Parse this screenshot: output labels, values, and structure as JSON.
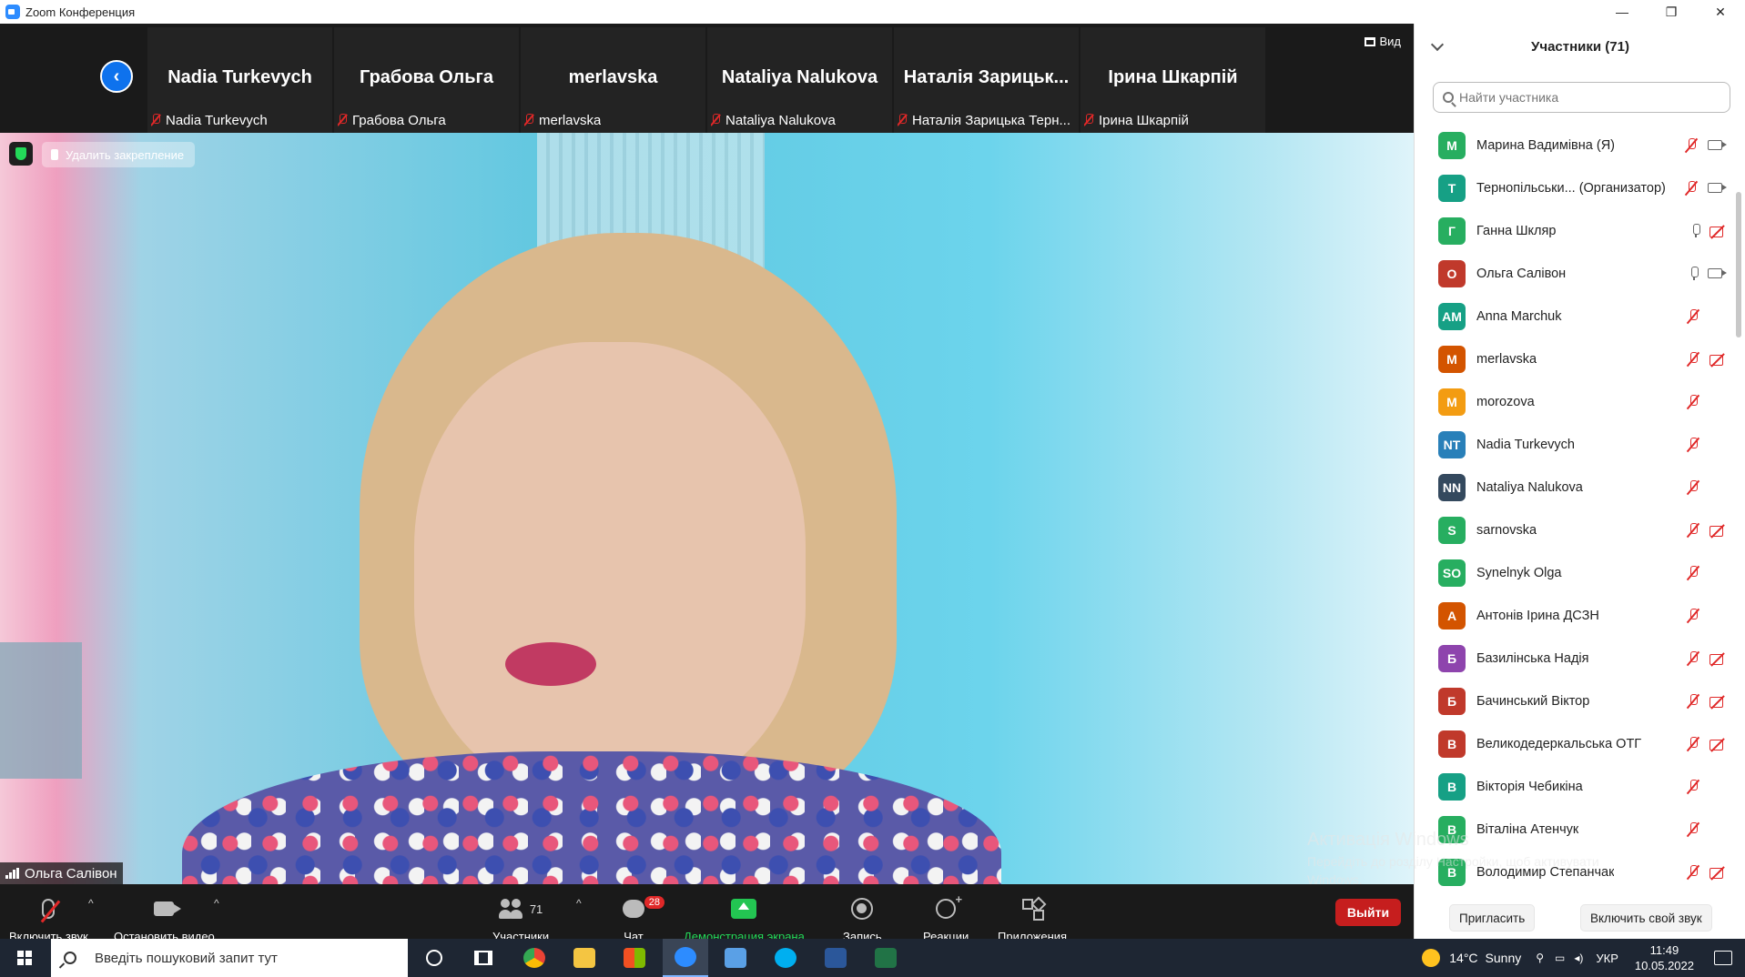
{
  "window": {
    "title": "Zoom Конференция",
    "controls": [
      "—",
      "❐",
      "✕"
    ]
  },
  "strip": {
    "view_label": "Вид",
    "thumbnails": [
      {
        "big": "Nadia Turkevych",
        "small": "Nadia Turkevych"
      },
      {
        "big": "Грабова Ольга",
        "small": "Грабова Ольга"
      },
      {
        "big": "merlavska",
        "small": "merlavska"
      },
      {
        "big": "Nataliya Nalukova",
        "small": "Nataliya Nalukova"
      },
      {
        "big": "Наталія Зарицьк...",
        "small": "Наталія Зарицька Терн..."
      },
      {
        "big": "Ірина Шкарпій",
        "small": "Ірина Шкарпій"
      }
    ]
  },
  "video": {
    "unpin_label": "Удалить закрепление",
    "speaker_name": "Ольга Салівон"
  },
  "toolbar": {
    "unmute_label": "Включить звук",
    "stop_video_label": "Остановить видео",
    "participants_label": "Участники",
    "participants_count": "71",
    "chat_label": "Чат",
    "chat_badge": "28",
    "share_label": "Демонстрация экрана",
    "record_label": "Запись",
    "reactions_label": "Реакции",
    "apps_label": "Приложения",
    "leave_label": "Выйти",
    "share_color": "#23d959",
    "leave_color": "#c61e1e"
  },
  "panel": {
    "title": "Участники (71)",
    "search_placeholder": "Найти участника",
    "invite_label": "Пригласить",
    "unmute_self_label": "Включить свой звук",
    "participants": [
      {
        "initials": "М",
        "name": "Марина Вадимівна (Я)",
        "color": "#27ae60",
        "mic": "off",
        "cam": "on"
      },
      {
        "initials": "Т",
        "name": "Тернопільськи... (Организатор)",
        "color": "#16a085",
        "mic": "off",
        "cam": "on"
      },
      {
        "initials": "Г",
        "name": "Ганна Шкляр",
        "color": "#27ae60",
        "mic": "on",
        "cam": "off"
      },
      {
        "initials": "О",
        "name": "Ольга Салівон",
        "color": "#c0392b",
        "mic": "on",
        "cam": "on"
      },
      {
        "initials": "AM",
        "name": "Anna Marchuk",
        "color": "#16a085",
        "mic": "off",
        "cam": "none"
      },
      {
        "initials": "M",
        "name": "merlavska",
        "color": "#d35400",
        "mic": "off",
        "cam": "off"
      },
      {
        "initials": "M",
        "name": "morozova",
        "color": "#f39c12",
        "mic": "off",
        "cam": "none"
      },
      {
        "initials": "NT",
        "name": "Nadia Turkevych",
        "color": "#2980b9",
        "mic": "off",
        "cam": "none"
      },
      {
        "initials": "NN",
        "name": "Nataliya Nalukova",
        "color": "#34495e",
        "mic": "off",
        "cam": "none"
      },
      {
        "initials": "S",
        "name": "sarnovska",
        "color": "#27ae60",
        "mic": "off",
        "cam": "off"
      },
      {
        "initials": "SO",
        "name": "Synelnyk Olga",
        "color": "#27ae60",
        "mic": "off",
        "cam": "none"
      },
      {
        "initials": "А",
        "name": "Антонів Ірина ДСЗН",
        "color": "#d35400",
        "mic": "off",
        "cam": "none"
      },
      {
        "initials": "Б",
        "name": "Базилінська Надія",
        "color": "#8e44ad",
        "mic": "off",
        "cam": "off"
      },
      {
        "initials": "Б",
        "name": "Бачинський Віктор",
        "color": "#c0392b",
        "mic": "off",
        "cam": "off"
      },
      {
        "initials": "В",
        "name": "Великодедеркальська ОТГ",
        "color": "#c0392b",
        "mic": "off",
        "cam": "off"
      },
      {
        "initials": "В",
        "name": "Вікторія Чебикіна",
        "color": "#16a085",
        "mic": "off",
        "cam": "none"
      },
      {
        "initials": "В",
        "name": "Віталіна  Атенчук",
        "color": "#27ae60",
        "mic": "off",
        "cam": "none"
      },
      {
        "initials": "В",
        "name": "Володимир Степанчак",
        "color": "#27ae60",
        "mic": "off",
        "cam": "off"
      }
    ]
  },
  "activation": {
    "line1": "Активація Windows",
    "line2": "Перейдіть до розділу Настройки, щоб активувати",
    "line3": "Windows."
  },
  "taskbar": {
    "search_placeholder": "Введіть пошуковий запит тут",
    "weather_temp": "14°C",
    "weather_desc": "Sunny",
    "language": "УКР",
    "time": "11:49",
    "date": "10.05.2022"
  }
}
